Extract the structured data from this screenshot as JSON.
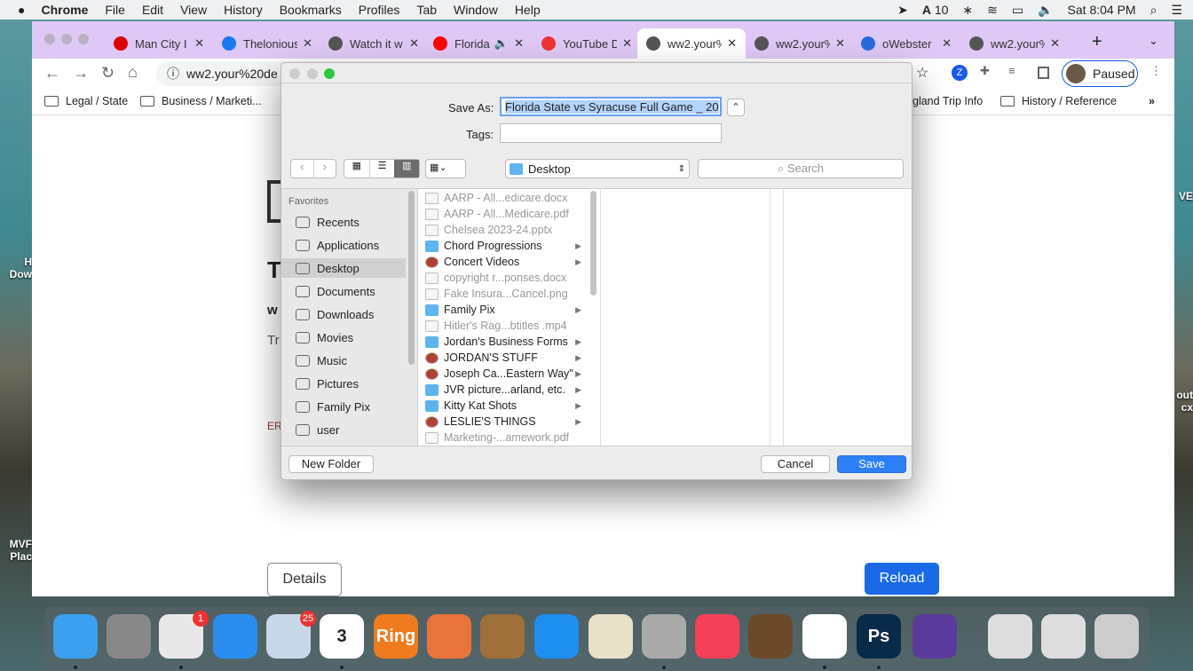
{
  "menubar": {
    "app": "Chrome",
    "items": [
      "File",
      "Edit",
      "View",
      "History",
      "Bookmarks",
      "Profiles",
      "Tab",
      "Window",
      "Help"
    ],
    "status": {
      "adobe": "10",
      "clock": "Sat 8:04 PM"
    }
  },
  "tabs": [
    {
      "title": "Man City I",
      "icon": "espn-icon",
      "color": "#d00"
    },
    {
      "title": "Thelonious",
      "icon": "facebook-icon",
      "color": "#1877f2"
    },
    {
      "title": "Watch it w",
      "icon": "globe-icon",
      "color": "#555"
    },
    {
      "title": "Florida",
      "icon": "youtube-icon",
      "color": "#f00",
      "audio": "🔈"
    },
    {
      "title": "YouTube D",
      "icon": "download-icon",
      "color": "#e33"
    },
    {
      "title": "ww2.your%",
      "icon": "globe-icon",
      "color": "#555",
      "active": true
    },
    {
      "title": "ww2.your%",
      "icon": "globe-icon",
      "color": "#555"
    },
    {
      "title": "oWebster",
      "icon": "webster-icon",
      "color": "#2a6ae0"
    },
    {
      "title": "ww2.your%",
      "icon": "globe-icon",
      "color": "#555"
    }
  ],
  "toolbar": {
    "url": "ww2.your%20de",
    "profile": "Paused"
  },
  "bookmarks": [
    "Legal / State",
    "Business / Marketi...",
    "gland Trip Info",
    "History / Reference"
  ],
  "page": {
    "heading": "T",
    "sub": "w",
    "text": "Tr",
    "error": "ER",
    "details": "Details",
    "reload": "Reload"
  },
  "desktop": {
    "label1": "H\nDow",
    "label2": "MVF\nPlac",
    "label3": "VE",
    "label4": "out\ncx"
  },
  "dialog": {
    "save_as_label": "Save As:",
    "save_as_value": "Florida State vs Syracuse Full Game _ 20",
    "tags_label": "Tags:",
    "location": "Desktop",
    "search_placeholder": "Search",
    "sidebar_header": "Favorites",
    "sidebar": [
      "Recents",
      "Applications",
      "Desktop",
      "Documents",
      "Downloads",
      "Movies",
      "Music",
      "Pictures",
      "Family Pix",
      "user"
    ],
    "files": [
      {
        "name": "AARP - All...edicare.docx",
        "kind": "doc",
        "dim": true
      },
      {
        "name": "AARP - All...Medicare.pdf",
        "kind": "doc",
        "dim": true
      },
      {
        "name": "Chelsea 2023-24.pptx",
        "kind": "doc",
        "dim": true
      },
      {
        "name": "Chord Progressions",
        "kind": "folder",
        "arrow": true
      },
      {
        "name": "Concert Videos",
        "kind": "alias",
        "arrow": true
      },
      {
        "name": "copyright r...ponses.docx",
        "kind": "doc",
        "dim": true
      },
      {
        "name": "Fake Insura...Cancel.png",
        "kind": "doc",
        "dim": true
      },
      {
        "name": "Family Pix",
        "kind": "folder",
        "arrow": true
      },
      {
        "name": "Hitler's Rag...btitles .mp4",
        "kind": "doc",
        "dim": true
      },
      {
        "name": "Jordan's Business Forms",
        "kind": "folder",
        "arrow": true
      },
      {
        "name": "JORDAN'S STUFF",
        "kind": "alias",
        "arrow": true
      },
      {
        "name": "Joseph Ca...Eastern Way\"",
        "kind": "alias",
        "arrow": true
      },
      {
        "name": "JVR picture...arland, etc.",
        "kind": "folder",
        "arrow": true
      },
      {
        "name": "Kitty Kat Shots",
        "kind": "folder",
        "arrow": true
      },
      {
        "name": "LESLIE'S THINGS",
        "kind": "alias",
        "arrow": true
      },
      {
        "name": "Marketing-...amework.pdf",
        "kind": "doc",
        "dim": true
      }
    ],
    "new_folder": "New Folder",
    "cancel": "Cancel",
    "save": "Save"
  },
  "dock": [
    {
      "name": "finder",
      "color": "#3ba0f0"
    },
    {
      "name": "system-preferences",
      "color": "#888"
    },
    {
      "name": "chrome",
      "color": "#e8e8e8",
      "badge": "1"
    },
    {
      "name": "safari",
      "color": "#2a8ef0"
    },
    {
      "name": "mail",
      "color": "#c8d8e8",
      "badge": "25"
    },
    {
      "name": "calendar",
      "color": "#fff",
      "text": "3"
    },
    {
      "name": "ring",
      "color": "#f07b1e",
      "text": "Ring"
    },
    {
      "name": "powerpoint",
      "color": "#e8743b"
    },
    {
      "name": "contacts",
      "color": "#a0703a"
    },
    {
      "name": "app-store",
      "color": "#1d8ff0"
    },
    {
      "name": "word",
      "color": "#e8e0c8"
    },
    {
      "name": "calculator",
      "color": "#aaa"
    },
    {
      "name": "music",
      "color": "#f5405a"
    },
    {
      "name": "garageband",
      "color": "#6a4a2a"
    },
    {
      "name": "photos",
      "color": "#fff"
    },
    {
      "name": "photoshop",
      "color": "#0a2a4a",
      "text": "Ps"
    },
    {
      "name": "imovie",
      "color": "#5a3a9a"
    },
    {
      "name": "recent-window-1",
      "color": "#ddd"
    },
    {
      "name": "recent-window-2",
      "color": "#ddd"
    },
    {
      "name": "trash",
      "color": "#ccc"
    }
  ]
}
